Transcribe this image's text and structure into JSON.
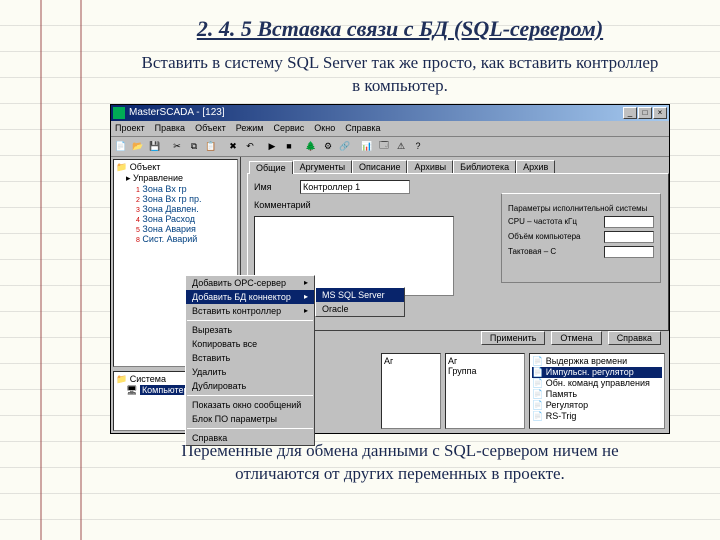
{
  "page": {
    "title": "2. 4. 5 Вставка связи с БД (SQL-сервером)",
    "intro": "Вставить в систему SQL Server так же просто, как вставить контроллер в компьютер.",
    "outro": "Переменные для обмена данными с SQL-сервером ничем не отличаются от других переменных в проекте."
  },
  "app": {
    "title": "MasterSCADA - [123]",
    "menus": [
      "Проект",
      "Правка",
      "Объект",
      "Режим",
      "Сервис",
      "Окно",
      "Справка"
    ],
    "winbuttons": [
      "_",
      "□",
      "×"
    ]
  },
  "tree1": {
    "root": "Объект",
    "nodes": [
      "Управление",
      "Зона Bx гр",
      "Зона Bx гр пр.",
      "Зона Давлен.",
      "Зона Расход",
      "Зона Авария",
      "Сист. Аварий"
    ]
  },
  "tree2": {
    "root": "Система",
    "selected": "Компьютер 1"
  },
  "tabs": [
    "Общие",
    "Аргументы",
    "Описание",
    "Архивы",
    "Библиотека",
    "Архив"
  ],
  "form": {
    "name_label": "Имя",
    "name_value": "Контроллер 1",
    "comment_label": "Комментарий"
  },
  "group": {
    "title": "Параметры исполнительной системы",
    "rows": [
      "CPU – частота кГц",
      "Объём компьютера",
      "Тактовая – C"
    ]
  },
  "buttons": {
    "apply": "Применить",
    "cancel": "Отмена",
    "help": "Справка"
  },
  "ctxmenu": {
    "items": [
      "Добавить OPC-сервер",
      "Добавить БД коннектор",
      "Вставить контроллер",
      "Вырезать",
      "Копировать все",
      "Вставить",
      "Удалить",
      "Дублировать",
      "Показать окно сообщений",
      "Блок ПО параметры",
      "Справка"
    ],
    "hl_index": 1
  },
  "submenu": {
    "items": [
      "MS SQL Server",
      "Oracle"
    ],
    "hl_index": 0
  },
  "bottom": {
    "list1": [
      "Аг"
    ],
    "list2": [
      "Аг",
      "Группа"
    ],
    "list3": [
      "Выдержка времени",
      "Импульсн. регулятор",
      "Обн. команд управления",
      "Память",
      "Регулятор",
      "RS-Trig"
    ]
  }
}
